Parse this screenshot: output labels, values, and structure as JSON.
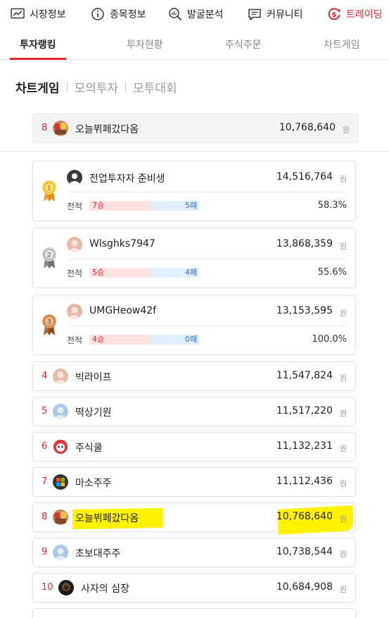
{
  "topnav": [
    {
      "label": "시장정보",
      "icon": "chart-icon"
    },
    {
      "label": "종목정보",
      "icon": "info-icon"
    },
    {
      "label": "발굴분석",
      "icon": "analysis-search-icon"
    },
    {
      "label": "커뮤니티",
      "icon": "chat-icon"
    },
    {
      "label": "트레이딩",
      "icon": "trading-dollar-icon"
    }
  ],
  "subtabs": [
    "투자랭킹",
    "투자현황",
    "주식주문",
    "차트게임"
  ],
  "categories": [
    "차트게임",
    "모의투자",
    "모투대회"
  ],
  "currency": "원",
  "record_label": "전적",
  "my_rank": {
    "rank": "8",
    "name": "오늘뷔페갔다옴",
    "amount": "10,768,640"
  },
  "top3": [
    {
      "rank": "1",
      "name": "전업투자자 준비생",
      "amount": "14,516,764",
      "wins": "7승",
      "losses": "5패",
      "win_ratio": 0.583,
      "pct": "58.3%"
    },
    {
      "rank": "2",
      "name": "Wlsghks7947",
      "amount": "13,868,359",
      "wins": "5승",
      "losses": "4패",
      "win_ratio": 0.556,
      "pct": "55.6%"
    },
    {
      "rank": "3",
      "name": "UMGHeow42f",
      "amount": "13,153,595",
      "wins": "4승",
      "losses": "0패",
      "win_ratio": 1.0,
      "pct": "100.0%"
    }
  ],
  "ranks": [
    {
      "rank": "4",
      "name": "빅라이프",
      "amount": "11,547,824"
    },
    {
      "rank": "5",
      "name": "떡상기원",
      "amount": "11,517,220"
    },
    {
      "rank": "6",
      "name": "주식쿨",
      "amount": "11,132,231"
    },
    {
      "rank": "7",
      "name": "마소주주",
      "amount": "11,112,436"
    },
    {
      "rank": "8",
      "name": "오늘뷔페갔다옴",
      "amount": "10,768,640"
    },
    {
      "rank": "9",
      "name": "초보대주주",
      "amount": "10,738,544"
    },
    {
      "rank": "10",
      "name": "사자의 심장",
      "amount": "10,684,908"
    }
  ],
  "colors": {
    "accent": "#e0262d",
    "highlight": "#fff200",
    "loss": "#3b6fc4"
  }
}
